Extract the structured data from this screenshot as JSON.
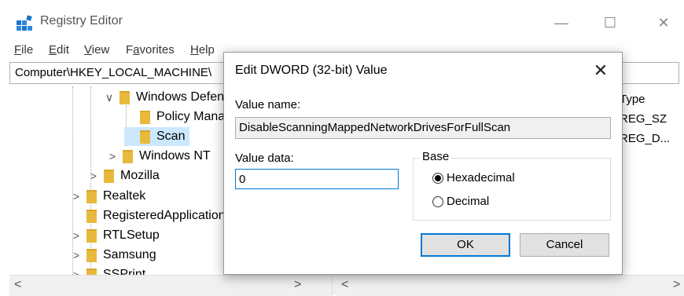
{
  "window": {
    "title": "Registry Editor",
    "controls": {
      "minimize": "—",
      "maximize": "☐",
      "close": "✕"
    }
  },
  "menu": [
    {
      "key": "F",
      "rest": "ile"
    },
    {
      "key": "E",
      "rest": "dit"
    },
    {
      "key": "V",
      "rest": "iew"
    },
    {
      "key": "a",
      "pre": "F",
      "rest": "vorites"
    },
    {
      "key": "H",
      "rest": "elp"
    }
  ],
  "address": "Computer\\HKEY_LOCAL_MACHINE\\",
  "tree": [
    {
      "label": "Windows Defender",
      "chev": "∨"
    },
    {
      "label": "Policy Manager",
      "chev": ""
    },
    {
      "label": "Scan",
      "chev": ""
    },
    {
      "label": "Windows NT",
      "chev": ">"
    },
    {
      "label": "Mozilla",
      "chev": ">"
    },
    {
      "label": "Realtek",
      "chev": ">"
    },
    {
      "label": "RegisteredApplications",
      "chev": ""
    },
    {
      "label": "RTLSetup",
      "chev": ">"
    },
    {
      "label": "Samsung",
      "chev": ">"
    },
    {
      "label": "SSPrint",
      "chev": ">"
    }
  ],
  "right_pane": {
    "header_type": "Type",
    "types": [
      "REG_SZ",
      "REG_D..."
    ]
  },
  "scroll": {
    "left": "<",
    "right": ">"
  },
  "dialog": {
    "title": "Edit DWORD (32-bit) Value",
    "close": "✕",
    "value_name_label": "Value name:",
    "value_name": "DisableScanningMappedNetworkDrivesForFullScan",
    "value_data_label": "Value data:",
    "value_data": "0",
    "base_label": "Base",
    "hex_label": "Hexadecimal",
    "dec_label": "Decimal",
    "ok": "OK",
    "cancel": "Cancel"
  }
}
